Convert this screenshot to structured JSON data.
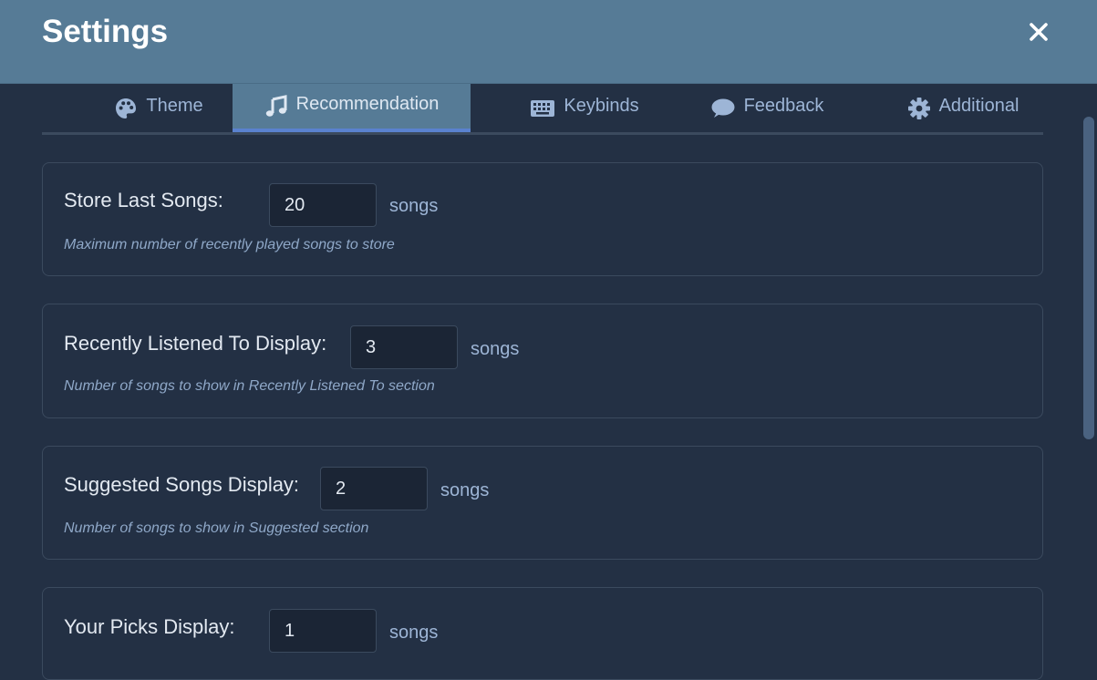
{
  "header": {
    "title": "Settings"
  },
  "tabs": [
    {
      "label": "Theme",
      "icon": "palette-icon",
      "active": false
    },
    {
      "label": "Recommendation",
      "icon": "music-note-icon",
      "active": true
    },
    {
      "label": "Keybinds",
      "icon": "keyboard-icon",
      "active": false
    },
    {
      "label": "Feedback",
      "icon": "comment-icon",
      "active": false
    },
    {
      "label": "Additional",
      "icon": "gear-icon",
      "active": false
    }
  ],
  "settings": [
    {
      "label": "Store Last Songs:",
      "value": "20",
      "unit": "songs",
      "description": "Maximum number of recently played songs to store"
    },
    {
      "label": "Recently Listened To Display:",
      "value": "3",
      "unit": "songs",
      "description": "Number of songs to show in Recently Listened To section"
    },
    {
      "label": "Suggested Songs Display:",
      "value": "2",
      "unit": "songs",
      "description": "Number of songs to show in Suggested section"
    },
    {
      "label": "Your Picks Display:",
      "value": "1",
      "unit": "songs",
      "description": ""
    }
  ],
  "colors": {
    "header_bg": "#567b96",
    "panel_bg": "#233044",
    "active_tab_bg": "#567b96",
    "active_tab_underline": "#5a82cf",
    "muted_text": "#9db5d6"
  }
}
